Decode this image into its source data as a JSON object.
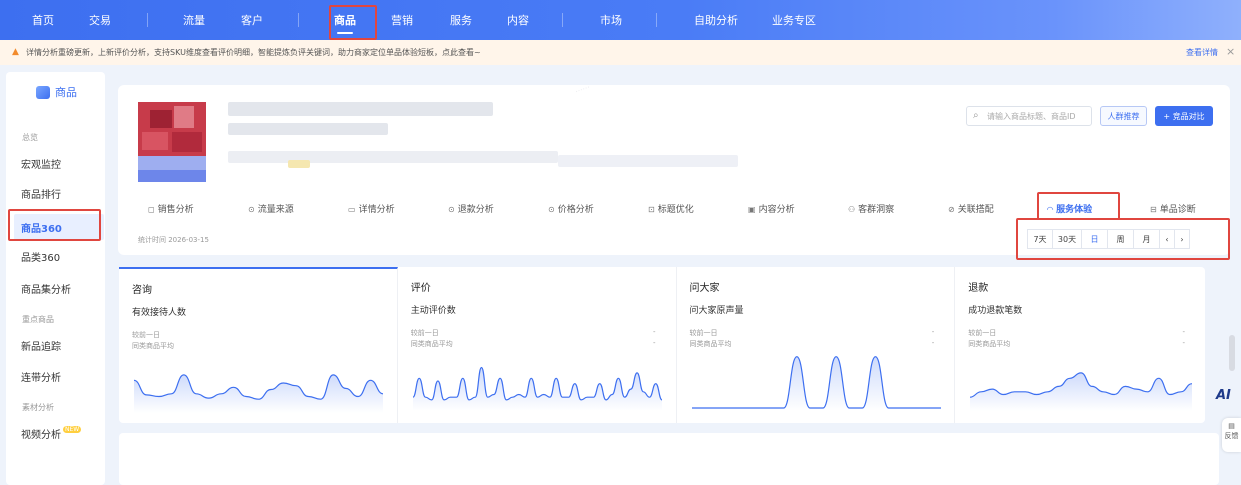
{
  "top_nav": {
    "items": [
      "首页",
      "交易",
      "流量",
      "客户",
      "商品",
      "营销",
      "服务",
      "内容",
      "市场",
      "自助分析",
      "业务专区"
    ],
    "active": "商品"
  },
  "notice": {
    "text": "详情分析重磅更新，上新评价分析，支持SKU维度查看评价明细，智能提炼负评关键词，助力商家定位单品体验短板，点此查看~",
    "link": "查看详情",
    "close": "×"
  },
  "sidebar": {
    "title": "商品",
    "group_overview": "总览",
    "group_key": "重点商品",
    "group_material": "素材分析",
    "items": [
      "宏观监控",
      "商品排行",
      "商品360",
      "品类360",
      "商品集分析",
      "新品追踪",
      "连带分析",
      "视频分析"
    ],
    "active": "商品360",
    "new_badge": "NEW"
  },
  "product": {
    "search_placeholder": "请输入商品标题、商品ID",
    "crowd_button": "人群推荐",
    "compare_button": "+ 竞品对比",
    "stat_time": "统计时间 2026-03-15",
    "tabs": [
      {
        "label": "销售分析",
        "icon": "shopping-bag-icon"
      },
      {
        "label": "流量来源",
        "icon": "flow-icon"
      },
      {
        "label": "详情分析",
        "icon": "detail-icon"
      },
      {
        "label": "退款分析",
        "icon": "refund-icon"
      },
      {
        "label": "价格分析",
        "icon": "price-icon"
      },
      {
        "label": "标题优化",
        "icon": "title-icon"
      },
      {
        "label": "内容分析",
        "icon": "content-icon"
      },
      {
        "label": "客群洞察",
        "icon": "users-icon"
      },
      {
        "label": "关联搭配",
        "icon": "link-icon"
      },
      {
        "label": "服务体验",
        "icon": "headset-icon"
      },
      {
        "label": "单品诊断",
        "icon": "diagnose-icon"
      }
    ],
    "active_tab": "服务体验",
    "ranges": [
      "7天",
      "30天",
      "日",
      "周",
      "月"
    ],
    "active_range": "日",
    "prev": "‹",
    "next": "›"
  },
  "cards": [
    {
      "title": "咨询",
      "metric": "有效接待人数",
      "line1": "较前一日",
      "line2": "同类商品平均",
      "value1": "",
      "value2": "",
      "trend": [
        0.55,
        0.28,
        0.25,
        0.3,
        0.65,
        0.3,
        0.22,
        0.3,
        0.42,
        0.25,
        0.2,
        0.38,
        0.5,
        0.45,
        0.25,
        0.2,
        0.65,
        0.4,
        0.25,
        0.55,
        0.3
      ]
    },
    {
      "title": "评价",
      "metric": "主动评价数",
      "line1": "较前一日",
      "line2": "同类商品平均",
      "value1": "-",
      "value2": "-",
      "trend": [
        0.2,
        0.55,
        0.2,
        0.15,
        0.5,
        0.15,
        0.2,
        0.2,
        0.55,
        0.15,
        0.2,
        0.75,
        0.2,
        0.25,
        0.55,
        0.15,
        0.2,
        0.25,
        0.2,
        0.55,
        0.2,
        0.25,
        0.2,
        0.55,
        0.2,
        0.2,
        0.45,
        0.15,
        0.2,
        0.2,
        0.45,
        0.15,
        0.25,
        0.55,
        0.2,
        0.35,
        0.65,
        0.3,
        0.2,
        0.45,
        0.15
      ]
    },
    {
      "title": "问大家",
      "metric": "问大家原声量",
      "line1": "较前一日",
      "line2": "同类商品平均",
      "value1": "-",
      "value2": "-",
      "trend": [
        0,
        0,
        0,
        0,
        0,
        0,
        0,
        0,
        0.95,
        0,
        0,
        0.95,
        0,
        0,
        0.95,
        0,
        0,
        0,
        0,
        0
      ]
    },
    {
      "title": "退款",
      "metric": "成功退款笔数",
      "line1": "较前一日",
      "line2": "同类商品平均",
      "value1": "-",
      "value2": "-",
      "trend": [
        0.2,
        0.3,
        0.35,
        0.25,
        0.3,
        0.3,
        0.25,
        0.3,
        0.4,
        0.55,
        0.65,
        0.4,
        0.3,
        0.25,
        0.4,
        0.35,
        0.3,
        0.55,
        0.25,
        0.3,
        0.45
      ]
    }
  ],
  "float": {
    "ai": "AI",
    "feedback": "反馈"
  }
}
